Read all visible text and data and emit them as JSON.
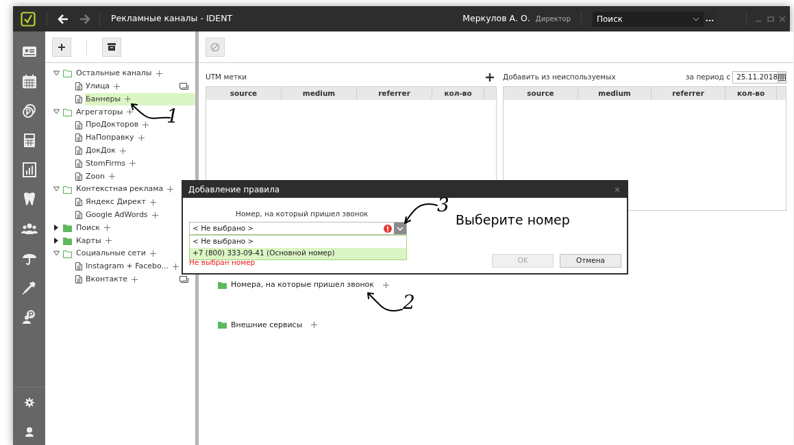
{
  "window": {
    "title": "Рекламные каналы - IDENT",
    "user": "Меркулов А. О.",
    "role": "Директор"
  },
  "search": {
    "placeholder": "Поиск",
    "more": "..."
  },
  "tree": [
    {
      "label": "Остальные каналы",
      "kind": "folder",
      "expanded": true,
      "selected": false,
      "children": [
        {
          "label": "Улица",
          "kind": "page",
          "selected": false,
          "has_comment": true
        },
        {
          "label": "Баннеры",
          "kind": "page",
          "selected": true,
          "has_comment": false
        }
      ]
    },
    {
      "label": "Агрегаторы",
      "kind": "folder",
      "expanded": true,
      "selected": false,
      "children": [
        {
          "label": "ПроДокторов",
          "kind": "page",
          "selected": false,
          "has_comment": false
        },
        {
          "label": "НаПоправку",
          "kind": "page",
          "selected": false,
          "has_comment": false
        },
        {
          "label": "ДокДок",
          "kind": "page",
          "selected": false,
          "has_comment": false
        },
        {
          "label": "StomFirms",
          "kind": "page",
          "selected": false,
          "has_comment": false
        },
        {
          "label": "Zoon",
          "kind": "page",
          "selected": false,
          "has_comment": false
        }
      ]
    },
    {
      "label": "Контекстная реклама",
      "kind": "folder",
      "expanded": true,
      "selected": false,
      "children": [
        {
          "label": "Яндекс Директ",
          "kind": "page",
          "selected": false,
          "has_comment": false
        },
        {
          "label": "Google AdWords",
          "kind": "page",
          "selected": false,
          "has_comment": false
        }
      ]
    },
    {
      "label": "Поиск",
      "kind": "folder",
      "expanded": false,
      "selected": false
    },
    {
      "label": "Карты",
      "kind": "folder",
      "expanded": false,
      "selected": false
    },
    {
      "label": "Социальные сети",
      "kind": "folder",
      "expanded": true,
      "selected": false,
      "children": [
        {
          "label": "Instagram + Facebo...",
          "kind": "page",
          "selected": false,
          "has_comment": false
        },
        {
          "label": "Вконтакте",
          "kind": "page",
          "selected": false,
          "has_comment": true
        }
      ]
    }
  ],
  "utm": {
    "title": "UTM метки",
    "columns": [
      "source",
      "medium",
      "referrer",
      "кол-во"
    ]
  },
  "unused": {
    "title": "Добавить из неиспользуемых",
    "period_label": "за период с",
    "date": "25.11.2018",
    "columns": [
      "source",
      "medium",
      "referrer",
      "кол-во"
    ]
  },
  "groups": [
    {
      "label": "Номера, на которые пришел звонок"
    },
    {
      "label": "Внешние сервисы"
    }
  ],
  "dialog": {
    "title": "Добавление правила",
    "field_label": "Номер, на который пришел звонок",
    "value": "< Не выбрано >",
    "invalid": true,
    "options": [
      {
        "label": "< Не выбрано >",
        "highlighted": false
      },
      {
        "label": "+7 (800) 333-09-41 (Основной номер)",
        "highlighted": true
      }
    ],
    "error": "Не выбран номер",
    "buttons": [
      {
        "label": "OK",
        "disabled": true
      },
      {
        "label": "Отмена",
        "disabled": false
      }
    ]
  },
  "annotations": [
    {
      "label": "1"
    },
    {
      "label": "2"
    },
    {
      "label": "3"
    },
    {
      "label": "Выберите номер"
    }
  ]
}
